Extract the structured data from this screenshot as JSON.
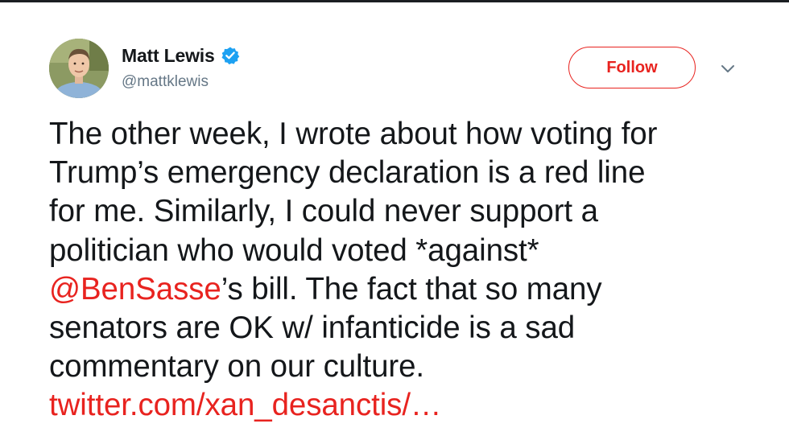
{
  "tweet": {
    "author": {
      "display_name": "Matt Lewis",
      "handle": "@mattklewis",
      "verified": true
    },
    "follow_label": "Follow",
    "lines": [
      "The other week, I wrote about how voting for",
      "Trump’s emergency declaration is a red line",
      "for me. Similarly, I could never support a",
      "politician who would voted *against*"
    ],
    "mention": "@BenSasse",
    "mention_line_rest": "’s bill. The fact that so many",
    "lines_after": [
      "senators are OK w/ infanticide is a sad",
      "commentary on our culture."
    ],
    "link": "twitter.com/xan_desanctis/…"
  },
  "icons": {
    "avatar": "avatar-photo",
    "verified": "verified-badge-icon",
    "caret": "chevron-down-icon"
  },
  "colors": {
    "accent": "#e8231f",
    "verified_blue": "#1da1f2",
    "handle_gray": "#657786",
    "text": "#14171a"
  }
}
